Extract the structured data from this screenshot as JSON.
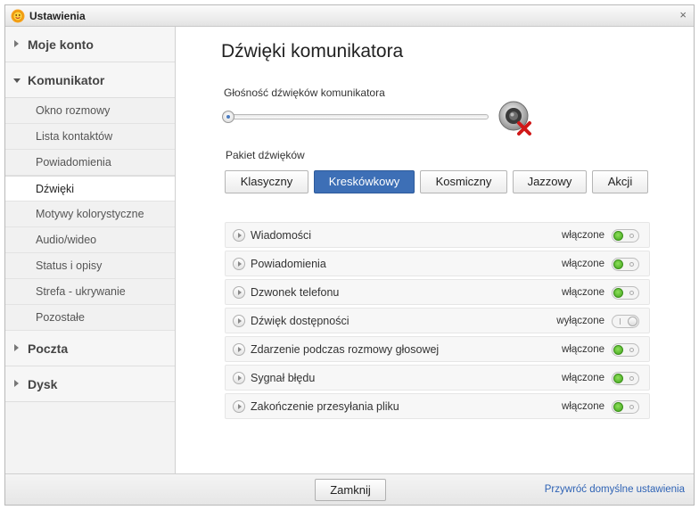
{
  "window": {
    "title": "Ustawienia",
    "close_glyph": "×"
  },
  "sidebar": {
    "sections": [
      {
        "label": "Moje konto",
        "expanded": false
      },
      {
        "label": "Komunikator",
        "expanded": true
      },
      {
        "label": "Poczta",
        "expanded": false
      },
      {
        "label": "Dysk",
        "expanded": false
      }
    ],
    "items": [
      {
        "label": "Okno rozmowy",
        "active": false
      },
      {
        "label": "Lista kontaktów",
        "active": false
      },
      {
        "label": "Powiadomienia",
        "active": false
      },
      {
        "label": "Dźwięki",
        "active": true
      },
      {
        "label": "Motywy kolorystyczne",
        "active": false
      },
      {
        "label": "Audio/wideo",
        "active": false
      },
      {
        "label": "Status i opisy",
        "active": false
      },
      {
        "label": "Strefa - ukrywanie",
        "active": false
      },
      {
        "label": "Pozostałe",
        "active": false
      }
    ]
  },
  "main": {
    "title": "Dźwięki komunikatora",
    "volume": {
      "label": "Głośność dźwięków komunikatora",
      "level_percent": 0,
      "muted": true
    },
    "pack": {
      "label": "Pakiet dźwięków",
      "options": [
        "Klasyczny",
        "Kreskówkowy",
        "Kosmiczny",
        "Jazzowy",
        "Akcji"
      ],
      "selected": "Kreskówkowy"
    },
    "sounds": [
      {
        "name": "Wiadomości",
        "state": "włączone",
        "on": true
      },
      {
        "name": "Powiadomienia",
        "state": "włączone",
        "on": true
      },
      {
        "name": "Dzwonek telefonu",
        "state": "włączone",
        "on": true
      },
      {
        "name": "Dźwięk dostępności",
        "state": "wyłączone",
        "on": false
      },
      {
        "name": "Zdarzenie podczas rozmowy głosowej",
        "state": "włączone",
        "on": true
      },
      {
        "name": "Sygnał błędu",
        "state": "włączone",
        "on": true
      },
      {
        "name": "Zakończenie przesyłania pliku",
        "state": "włączone",
        "on": true
      }
    ]
  },
  "footer": {
    "close_label": "Zamknij",
    "restore_label": "Przywróć domyślne ustawienia"
  },
  "colors": {
    "accent": "#3d6fb6",
    "toggle_on": "#4caf22",
    "link": "#2f63b5"
  }
}
